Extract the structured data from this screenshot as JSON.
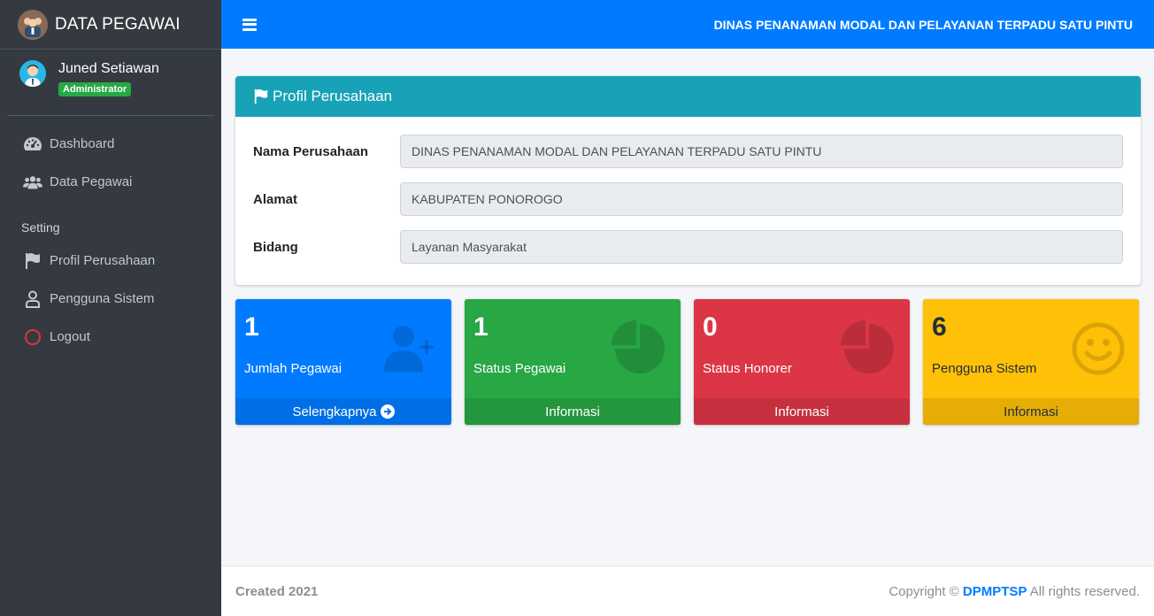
{
  "sidebar": {
    "brand": "DATA PEGAWAI",
    "user": {
      "name": "Juned Setiawan",
      "role": "Administrator"
    },
    "items": [
      {
        "label": "Dashboard",
        "icon": "tachometer-icon"
      },
      {
        "label": "Data Pegawai",
        "icon": "users-icon"
      }
    ],
    "section_header": "Setting",
    "settings_items": [
      {
        "label": "Profil Perusahaan",
        "icon": "flag-icon"
      },
      {
        "label": "Pengguna Sistem",
        "icon": "user-icon"
      },
      {
        "label": "Logout",
        "icon": "circle-icon"
      }
    ]
  },
  "header": {
    "title": "DINAS PENANAMAN MODAL DAN PELAYANAN TERPADU SATU PINTU"
  },
  "profile_card": {
    "title": "Profil Perusahaan",
    "fields": [
      {
        "label": "Nama Perusahaan",
        "value": "DINAS PENANAMAN MODAL DAN PELAYANAN TERPADU SATU PINTU"
      },
      {
        "label": "Alamat",
        "value": "KABUPATEN PONOROGO"
      },
      {
        "label": "Bidang",
        "value": "Layanan Masyarakat"
      }
    ]
  },
  "stat_boxes": [
    {
      "count": "1",
      "label": "Jumlah Pegawai",
      "footer": "Selengkapnya",
      "color": "#007bff",
      "icon": "user-plus-icon"
    },
    {
      "count": "1",
      "label": "Status Pegawai",
      "footer": "Informasi",
      "color": "#28a745",
      "icon": "pie-chart-icon"
    },
    {
      "count": "0",
      "label": "Status Honorer",
      "footer": "Informasi",
      "color": "#dc3545",
      "icon": "pie-chart-icon"
    },
    {
      "count": "6",
      "label": "Pengguna Sistem",
      "footer": "Informasi",
      "color": "#ffc107",
      "icon": "smile-icon"
    }
  ],
  "footer": {
    "created": "Created 2021",
    "copyright_prefix": "Copyright ©",
    "brand": "DPMPTSP",
    "copyright_suffix": "All rights reserved."
  }
}
